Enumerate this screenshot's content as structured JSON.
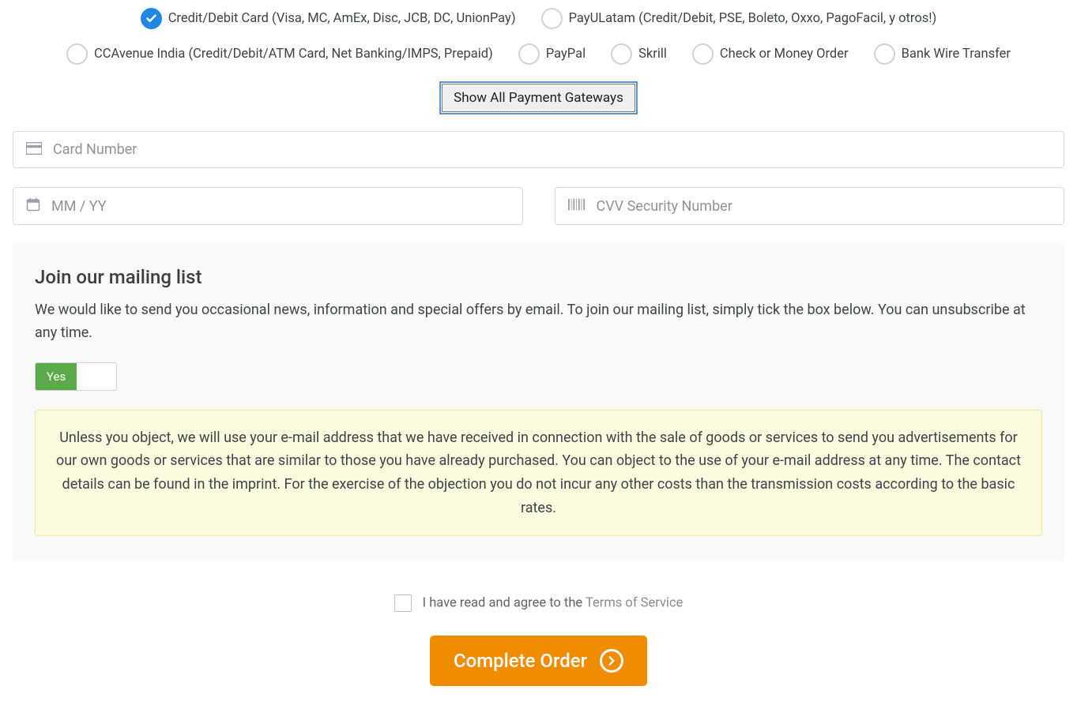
{
  "payment_methods": {
    "credit_debit": "Credit/Debit Card (Visa, MC, AmEx, Disc, JCB, DC, UnionPay)",
    "payulatam": "PayULatam (Credit/Debit, PSE, Boleto, Oxxo, PagoFacil, y otros!)",
    "ccavenue": "CCAvenue India (Credit/Debit/ATM Card, Net Banking/IMPS, Prepaid)",
    "paypal": "PayPal",
    "skrill": "Skrill",
    "check": "Check or Money Order",
    "bankwire": "Bank Wire Transfer"
  },
  "show_all_label": "Show All Payment Gateways",
  "card": {
    "number_placeholder": "Card Number",
    "expiry_placeholder": "MM / YY",
    "cvv_placeholder": "CVV Security Number"
  },
  "mailing": {
    "title": "Join our mailing list",
    "desc": "We would like to send you occasional news, information and special offers by email. To join our mailing list, simply tick the box below. You can unsubscribe at any time.",
    "toggle_yes": "Yes",
    "notice": "Unless you object, we will use your e-mail address that we have received in connection with the sale of goods or services to send you advertisements for our own goods or services that are similar to those you have already purchased. You can object to the use of your e-mail address at any time. The contact details can be found in the imprint. For the exercise of the objection you do not incur any other costs than the transmission costs according to the basic rates."
  },
  "terms": {
    "text": "I have read and agree to the ",
    "link": "Terms of Service"
  },
  "complete_label": "Complete Order"
}
